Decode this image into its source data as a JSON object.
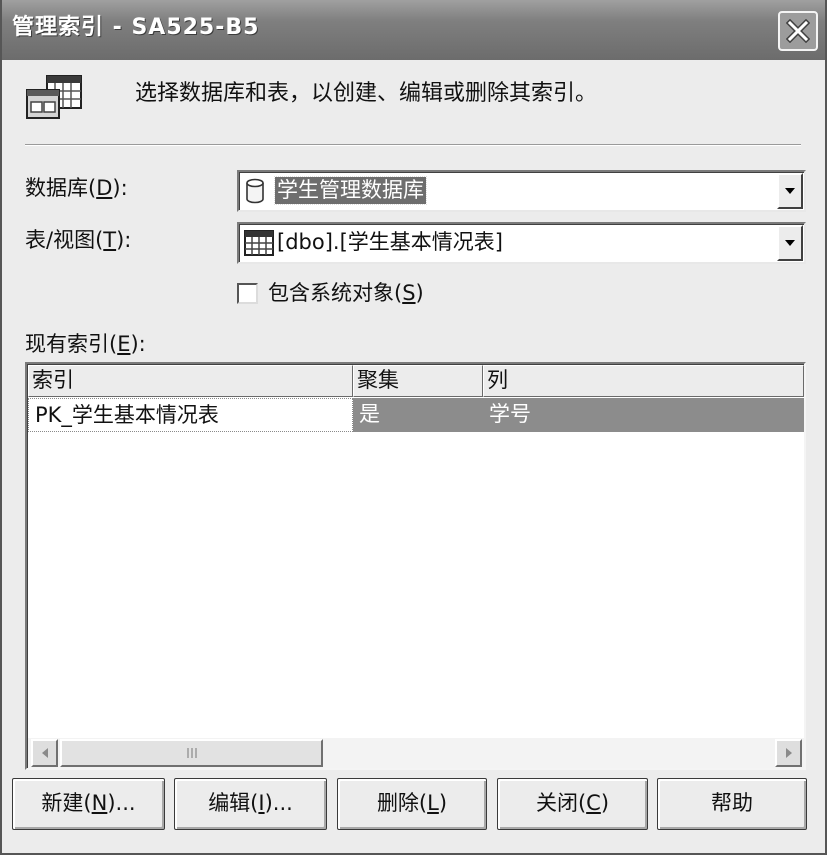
{
  "colors": {
    "face": "#ececec",
    "title_bar": "#7f7f7f",
    "selection": "#6e6e6e",
    "row_selection": "#8c8c8c"
  },
  "titlebar": {
    "title": "管理索引 - SA525-B5",
    "close_icon": "close-icon"
  },
  "header": {
    "icon": "table-window-icon",
    "description": "选择数据库和表，以创建、编辑或删除其索引。"
  },
  "database": {
    "label": "数据库(D):",
    "icon": "database-icon",
    "value": "学生管理数据库"
  },
  "table": {
    "label": "表/视图(T):",
    "icon": "table-icon",
    "value": "[dbo].[学生基本情况表]"
  },
  "include_system": {
    "label": "包含系统对象(S)",
    "checked": false
  },
  "indexes": {
    "label": "现有索引(E):",
    "columns": [
      "索引",
      "聚集",
      "列"
    ],
    "rows": [
      {
        "index": "PK_学生基本情况表",
        "clustered": "是",
        "column": "学号",
        "selected": true
      }
    ]
  },
  "buttons": {
    "new": "新建(N)...",
    "edit": "编辑(I)...",
    "delete": "删除(L)",
    "close": "关闭(C)",
    "help": "帮助"
  }
}
